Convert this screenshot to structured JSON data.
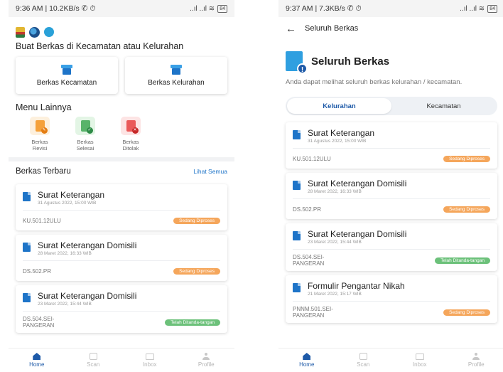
{
  "left": {
    "status": {
      "time": "9:36 AM | 10.2KB/s ✆ ⏱",
      "signal": "..ıl ..ıl ≋",
      "battery": "84"
    },
    "section_create": "Buat Berkas di Kecamatan atau Kelurahan",
    "create_cards": [
      "Berkas Kecamatan",
      "Berkas Kelurahan"
    ],
    "menu_title": "Menu Lainnya",
    "menu_items": [
      {
        "label": "Berkas Revisi",
        "icon": "pencil-document-icon"
      },
      {
        "label": "Berkas Selesai",
        "icon": "check-document-icon"
      },
      {
        "label": "Berkas Ditolak",
        "icon": "rejected-document-icon"
      }
    ],
    "recent_title": "Berkas Terbaru",
    "see_all": "Lihat Semua",
    "items": [
      {
        "title": "Surat Keterangan",
        "date": "31 Agustus 2022, 15:00 WIB",
        "code": "KU.501.12ULU",
        "status": "Sedang Diproses"
      },
      {
        "title": "Surat Keterangan Domisili",
        "date": "28 Maret 2022, 16:33 WIB",
        "code": "DS.502.PR",
        "status": "Sedang Diproses"
      },
      {
        "title": "Surat Keterangan Domisili",
        "date": "23 Maret 2022, 15:44 WIB",
        "code": "DS.504.SEI-PANGERAN",
        "status": "Telah Ditanda-tangan"
      }
    ]
  },
  "right": {
    "status": {
      "time": "9:37 AM | 7.3KB/s ✆ ⏱",
      "signal": "..ıl ..ıl ≋",
      "battery": "84"
    },
    "topbar_title": "Seluruh Berkas",
    "hero_title": "Seluruh Berkas",
    "hero_desc": "Anda dapat melihat seluruh berkas kelurahan / kecamatan.",
    "tabs": [
      "Kelurahan",
      "Kecamatan"
    ],
    "items": [
      {
        "title": "Surat Keterangan",
        "date": "31 Agustus 2022, 15:00 WIB",
        "code": "KU.501.12ULU",
        "status": "Sedang Diproses"
      },
      {
        "title": "Surat Keterangan Domisili",
        "date": "28 Maret 2022, 16:33 WIB",
        "code": "DS.502.PR",
        "status": "Sedang Diproses"
      },
      {
        "title": "Surat Keterangan Domisili",
        "date": "23 Maret 2022, 15:44 WIB",
        "code": "DS.504.SEI-PANGERAN",
        "status": "Telah Ditanda-tangan"
      },
      {
        "title": "Formulir Pengantar Nikah",
        "date": "21 Maret 2022, 15:17 WIB",
        "code": "PNNM.501.SEI-PANGERAN",
        "status": "Sedang Diproses"
      }
    ]
  },
  "nav": [
    "Home",
    "Scan",
    "Inbox",
    "Profile"
  ],
  "colors": {
    "primary": "#1e5aa8",
    "processing": "#f5a65b",
    "signed": "#6cc17a"
  }
}
